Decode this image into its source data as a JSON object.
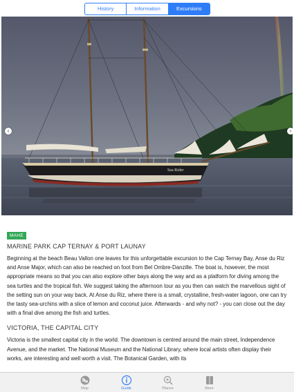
{
  "segments": {
    "history": "History",
    "information": "Information",
    "excursions": "Excursions",
    "active": "excursions"
  },
  "section1": {
    "badge": "MAHE",
    "title": "MARINE PARK CAP TERNAY & PORT LAUNAY",
    "body": "Beginning at the beach Beau Vallon one leaves for this unforgettable excursion to the Cap Ternay Bay, Anse du Riz and Anse Major, which can also be reached on foot from Bel Ombre-Danzille. The boat is, however, the most appropriate means so that you can also explore other bays along the way and as a platform for diving among the sea turtles and the tropical fish. We suggest taking the afternoon tour as you then can watch the marvellous sight of the setting sun on your way back. At Anse du Riz, where there is a small, crystalline, fresh-water lagoon, one can try the tasty sea-urchins with a slice of lemon and coconut juice. Afterwards - and why not? - you can close out the day with a final dive among the fish and turtles."
  },
  "section2": {
    "title": "VICTORIA, THE CAPITAL CITY",
    "body": "Victoria is the smallest capital city in the world. The downtown is centred around the main street, Independence Avenue, and the market. The National Museum and the National Library, where local artists often display their works, are interesting and well worth a visit. The Botanical Garden, with its"
  },
  "hero": {
    "boat_name": "Sea Rider"
  },
  "tabs": [
    {
      "label": "Map",
      "icon": "map-icon"
    },
    {
      "label": "Guide",
      "icon": "info-icon"
    },
    {
      "label": "Places",
      "icon": "magnifier-plus-icon"
    },
    {
      "label": "More",
      "icon": "book-icon"
    }
  ],
  "colors": {
    "accent": "#2f7df6",
    "badge": "#33a857"
  }
}
